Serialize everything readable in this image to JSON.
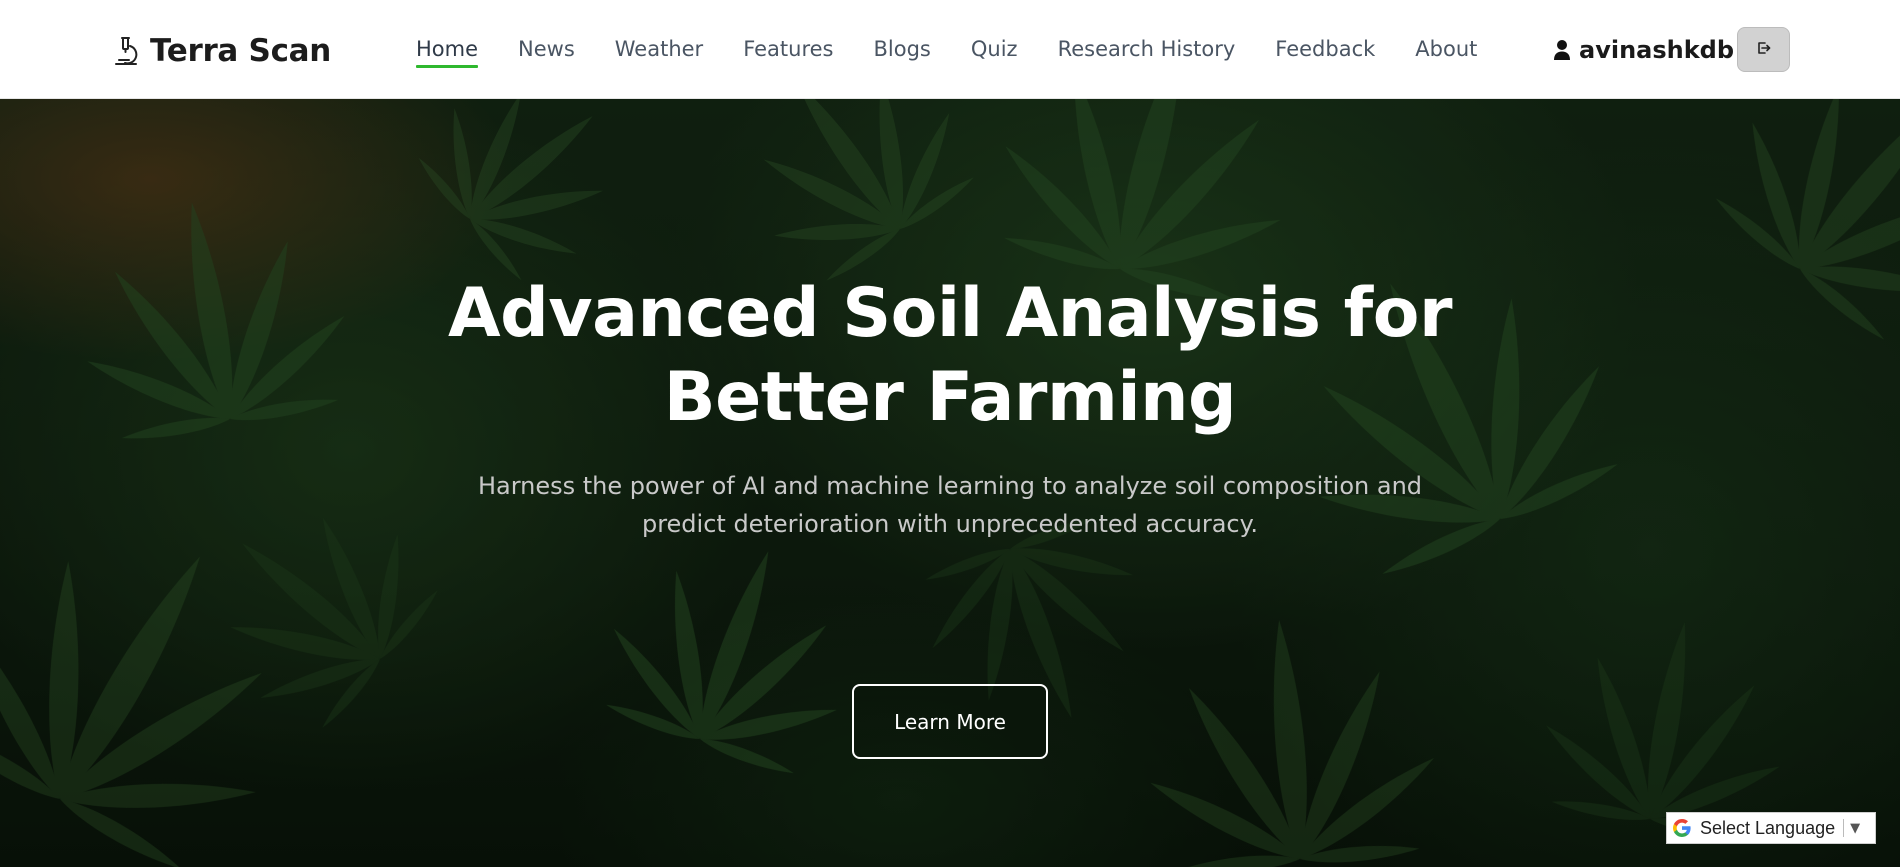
{
  "header": {
    "brand_name": "Terra Scan",
    "brand_icon": "microscope-icon",
    "nav": [
      {
        "label": "Home",
        "active": true
      },
      {
        "label": "News"
      },
      {
        "label": "Weather"
      },
      {
        "label": "Features"
      },
      {
        "label": "Blogs"
      },
      {
        "label": "Quiz"
      },
      {
        "label": "Research History"
      },
      {
        "label": "Feedback"
      },
      {
        "label": "About"
      }
    ],
    "username": "avinashkdb",
    "user_icon": "user-icon",
    "logout_icon": "logout-icon"
  },
  "hero": {
    "title_line1": "Advanced Soil Analysis for",
    "title_line2": "Better Farming",
    "subtitle_line1": "Harness the power of AI and machine learning to analyze soil composition and",
    "subtitle_line2": "predict deterioration with unprecedented accuracy.",
    "cta_label": "Learn More"
  },
  "language_selector": {
    "label": "Select Language",
    "icon": "google-g-icon"
  },
  "colors": {
    "accent_underline": "#2eb82e",
    "header_bg": "#ffffff",
    "hero_text": "#ffffff"
  }
}
